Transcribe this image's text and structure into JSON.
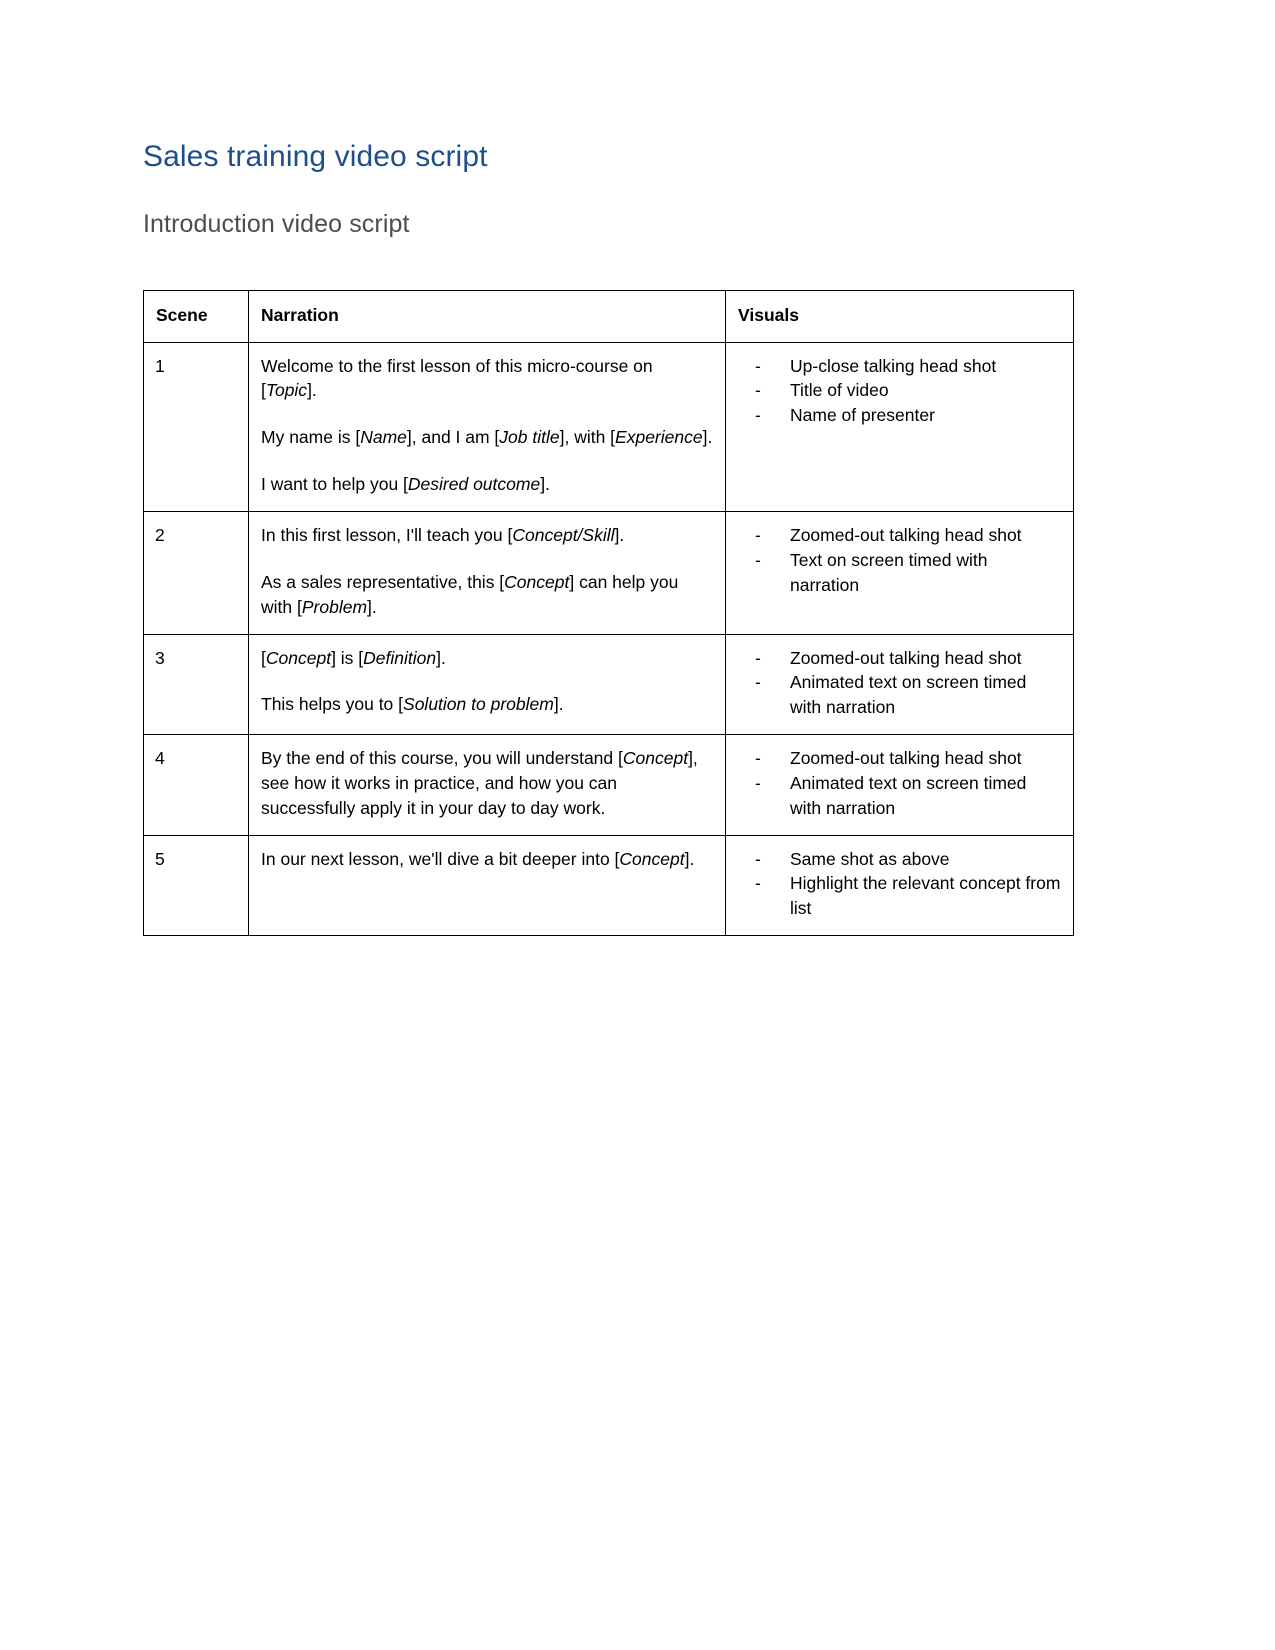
{
  "document": {
    "title": "Sales training video script",
    "subtitle": "Introduction video script",
    "title_color": "#1F4E8C",
    "subtitle_color": "#4D4D4D"
  },
  "table": {
    "headers": [
      "Scene",
      "Narration",
      "Visuals"
    ],
    "rows": [
      {
        "scene": "1",
        "narration": [
          [
            {
              "t": "Welcome to the first lesson of this micro-course on [",
              "i": false
            },
            {
              "t": "Topic",
              "i": true
            },
            {
              "t": "].",
              "i": false
            }
          ],
          [
            {
              "t": "My name is [",
              "i": false
            },
            {
              "t": "Name",
              "i": true
            },
            {
              "t": "], and I am [",
              "i": false
            },
            {
              "t": "Job title",
              "i": true
            },
            {
              "t": "], with [",
              "i": false
            },
            {
              "t": "Experience",
              "i": true
            },
            {
              "t": "].",
              "i": false
            }
          ],
          [
            {
              "t": "I want to help you [",
              "i": false
            },
            {
              "t": "Desired outcome",
              "i": true
            },
            {
              "t": "].",
              "i": false
            }
          ]
        ],
        "visuals": [
          "Up-close talking head shot",
          "Title of video",
          "Name of presenter"
        ]
      },
      {
        "scene": "2",
        "narration": [
          [
            {
              "t": "In this first lesson, I'll teach you [",
              "i": false
            },
            {
              "t": "Concept/Skill",
              "i": true
            },
            {
              "t": "].",
              "i": false
            }
          ],
          [
            {
              "t": "As a sales representative, this [",
              "i": false
            },
            {
              "t": "Concept",
              "i": true
            },
            {
              "t": "] can help you with [",
              "i": false
            },
            {
              "t": "Problem",
              "i": true
            },
            {
              "t": "].",
              "i": false
            }
          ]
        ],
        "visuals": [
          "Zoomed-out talking head shot",
          "Text on screen timed with narration"
        ]
      },
      {
        "scene": "3",
        "narration": [
          [
            {
              "t": "[",
              "i": false
            },
            {
              "t": "Concept",
              "i": true
            },
            {
              "t": "] is [",
              "i": false
            },
            {
              "t": "Definition",
              "i": true
            },
            {
              "t": "].",
              "i": false
            }
          ],
          [
            {
              "t": "This helps you to [",
              "i": false
            },
            {
              "t": "Solution to problem",
              "i": true
            },
            {
              "t": "].",
              "i": false
            }
          ]
        ],
        "visuals": [
          "Zoomed-out talking head shot",
          "Animated text on screen timed with narration"
        ]
      },
      {
        "scene": "4",
        "narration": [
          [
            {
              "t": "By the end of this course, you will understand [",
              "i": false
            },
            {
              "t": "Concept",
              "i": true
            },
            {
              "t": "], see how it works in practice, and how you can successfully apply it in your day to day work.",
              "i": false
            }
          ]
        ],
        "visuals": [
          "Zoomed-out talking head shot",
          "Animated text on screen timed with narration"
        ]
      },
      {
        "scene": "5",
        "narration": [
          [
            {
              "t": "In our next lesson, we'll dive a bit deeper into [",
              "i": false
            },
            {
              "t": "Concept",
              "i": true
            },
            {
              "t": "].",
              "i": false
            }
          ]
        ],
        "visuals": [
          "Same shot as above",
          "Highlight the relevant concept from list"
        ]
      }
    ]
  }
}
